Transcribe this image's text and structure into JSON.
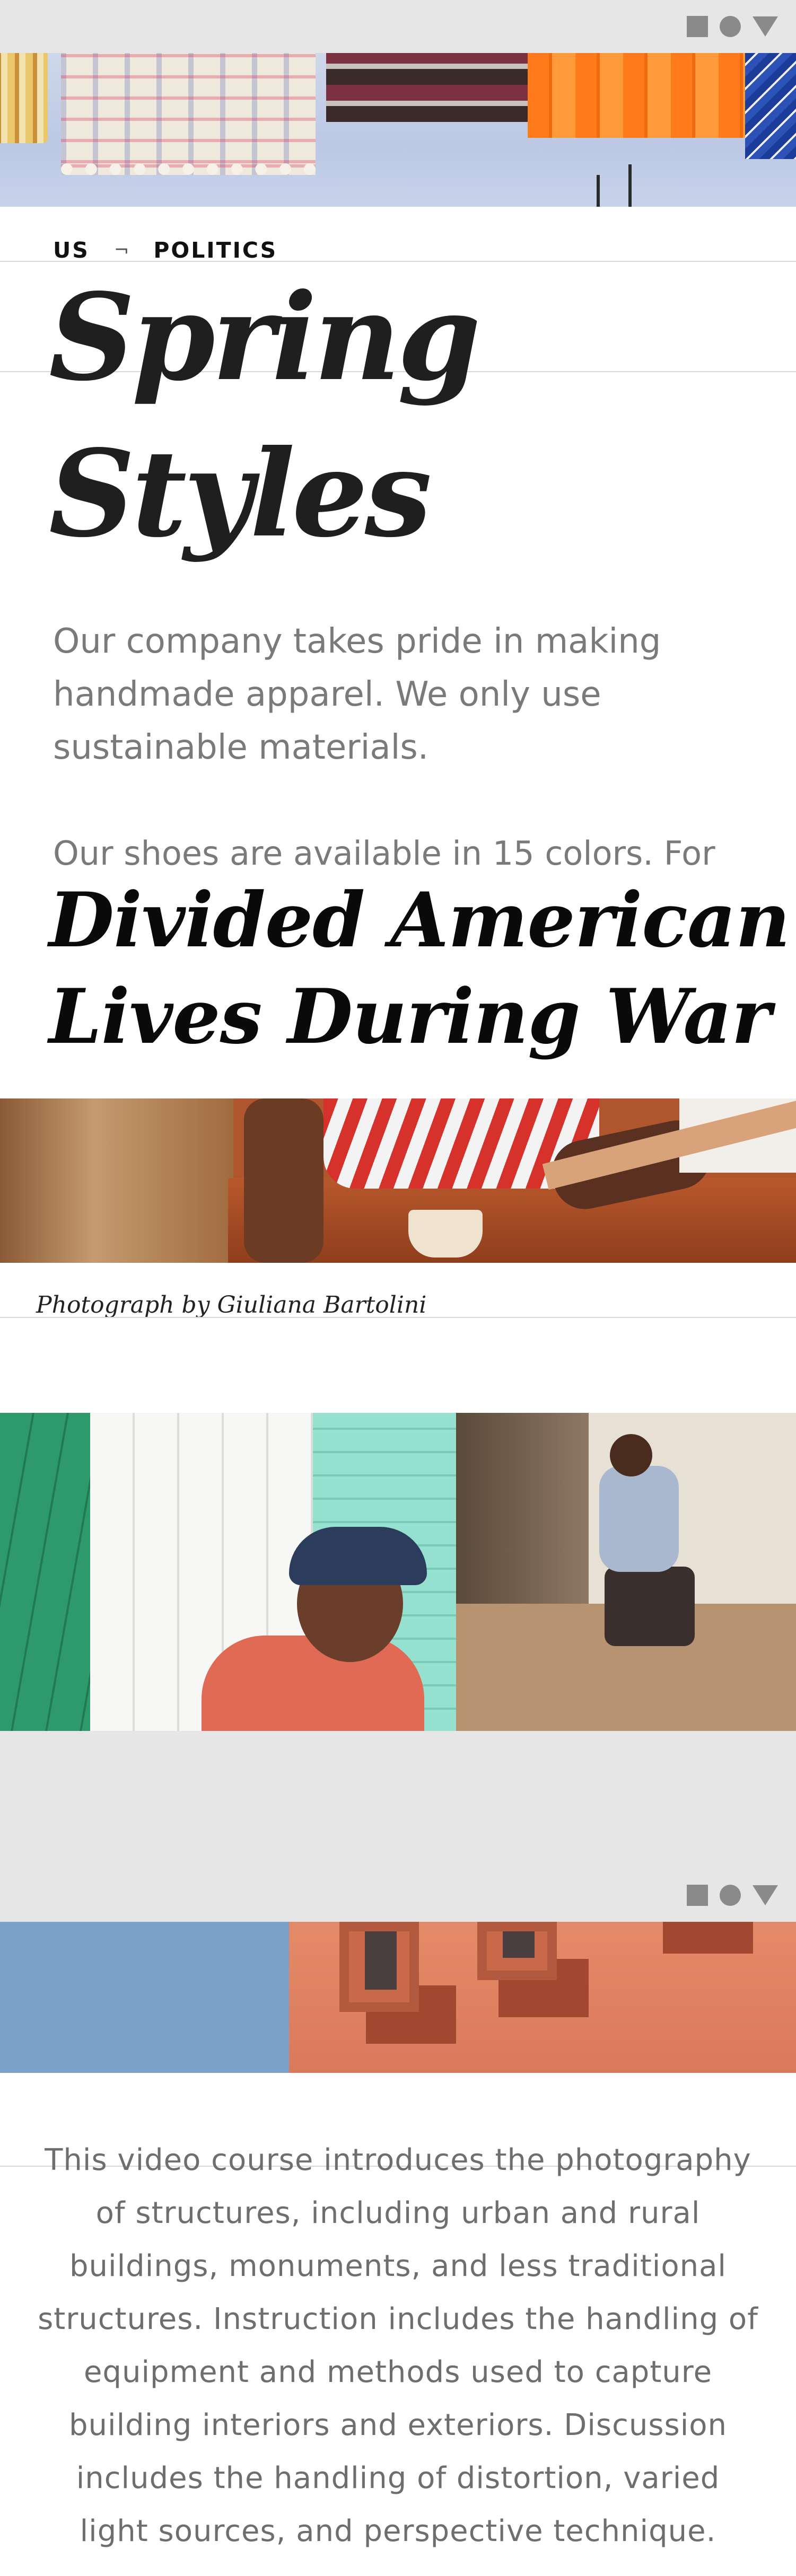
{
  "screen_1": {
    "status_icons": [
      "square-icon",
      "circle-icon",
      "triangle-icon"
    ],
    "breadcrumb": {
      "first": "US",
      "separator": "¬",
      "second": "POLITICS"
    },
    "title": "Spring Styles",
    "paragraph_1": "Our company takes pride in making handmade apparel. We only use sustainable materials.",
    "paragraph_2": "Our shoes are available in 15 colors. For",
    "headline": "Divided American Lives During War",
    "photo_caption": "Photograph by Giuliana Bartolini"
  },
  "screen_2": {
    "status_icons": [
      "square-icon",
      "circle-icon",
      "triangle-icon"
    ],
    "course_description": "This video course introduces the photography of structures, including urban and rural buildings, monuments, and less traditional structures. Instruction includes the handling of equipment and methods used to capture building interiors and exteriors. Discussion includes the handling of distortion, varied light sources, and perspective technique."
  },
  "colors": {
    "status_bar": "#e6e6e6",
    "status_icon": "#8a8a8a",
    "title_text": "#1f1f1f",
    "body_text": "#7a7a7a",
    "divider": "#d8d8d8"
  }
}
